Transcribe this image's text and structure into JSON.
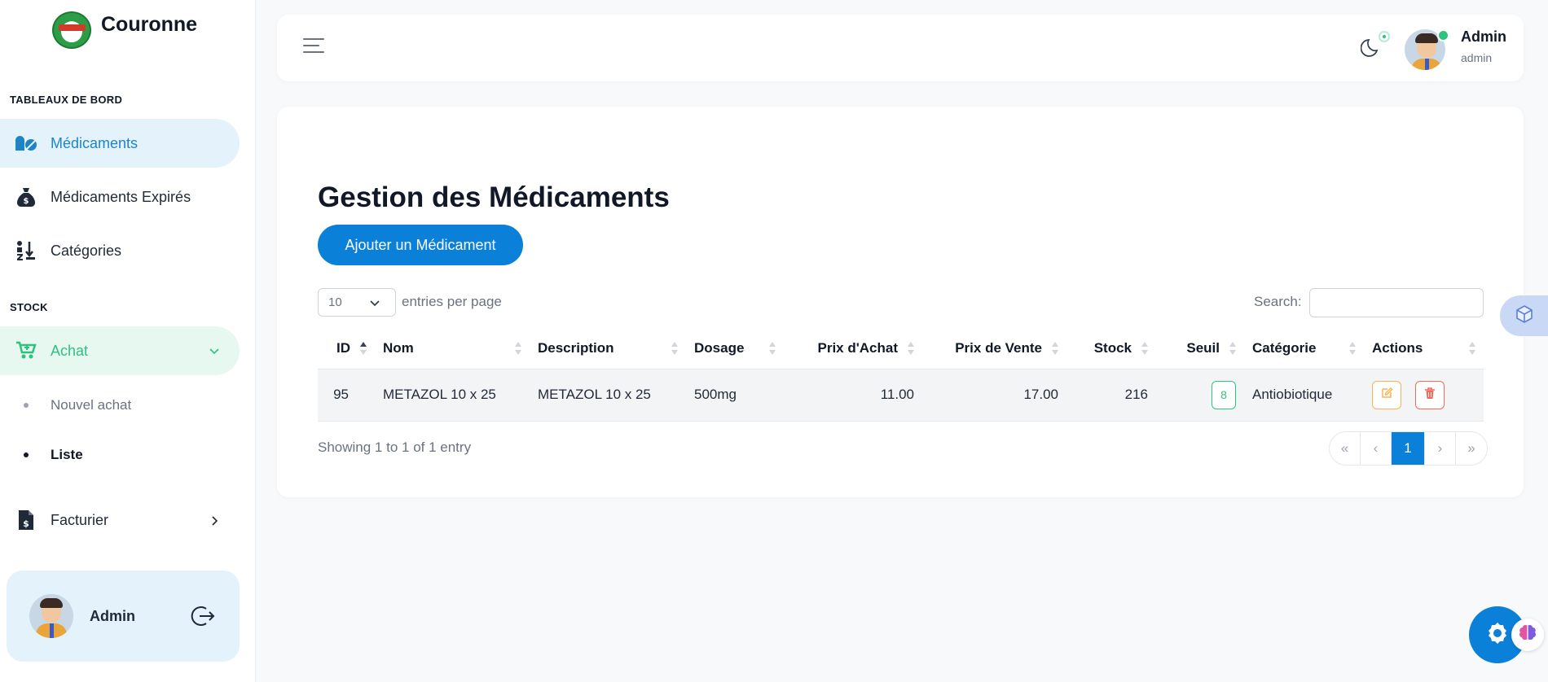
{
  "brand": {
    "name": "Couronne"
  },
  "sidebar": {
    "section_dashboards": "TABLEAUX DE BORD",
    "section_stock": "STOCK",
    "items": [
      {
        "label": "Médicaments",
        "icon": "pills-icon"
      },
      {
        "label": "Médicaments Expirés",
        "icon": "money-bag-icon"
      },
      {
        "label": "Catégories",
        "icon": "sort-icon"
      }
    ],
    "achat": {
      "label": "Achat",
      "icon": "cart-icon"
    },
    "achat_sub": [
      {
        "label": "Nouvel achat"
      },
      {
        "label": "Liste"
      }
    ],
    "facturier": {
      "label": "Facturier",
      "icon": "invoice-icon"
    },
    "user": {
      "name": "Admin"
    }
  },
  "topbar": {
    "user_name": "Admin",
    "user_role": "admin"
  },
  "main": {
    "title": "Gestion des Médicaments",
    "add_button": "Ajouter un Médicament",
    "page_length": "10",
    "length_label": "entries per page",
    "search_label": "Search:",
    "search_value": "",
    "columns": [
      "ID",
      "Nom",
      "Description",
      "Dosage",
      "Prix d'Achat",
      "Prix de Vente",
      "Stock",
      "Seuil",
      "Catégorie",
      "Actions"
    ],
    "rows": [
      {
        "id": "95",
        "nom": "METAZOL 10 x 25",
        "description": "METAZOL 10 x 25",
        "dosage": "500mg",
        "prix_achat": "11.00",
        "prix_vente": "17.00",
        "stock": "216",
        "seuil": "8",
        "categorie": "Antiobiotique"
      }
    ],
    "info": "Showing 1 to 1 of 1 entry",
    "pagination": {
      "first": "«",
      "prev": "‹",
      "current": "1",
      "next": "›",
      "last": "»"
    }
  },
  "colors": {
    "primary": "#0a80d9",
    "active_blue_bg": "#e3f2fb",
    "active_green_bg": "#e6f8ef",
    "green": "#2ec27e",
    "edit": "#f6b353",
    "delete": "#ef6b5a"
  }
}
